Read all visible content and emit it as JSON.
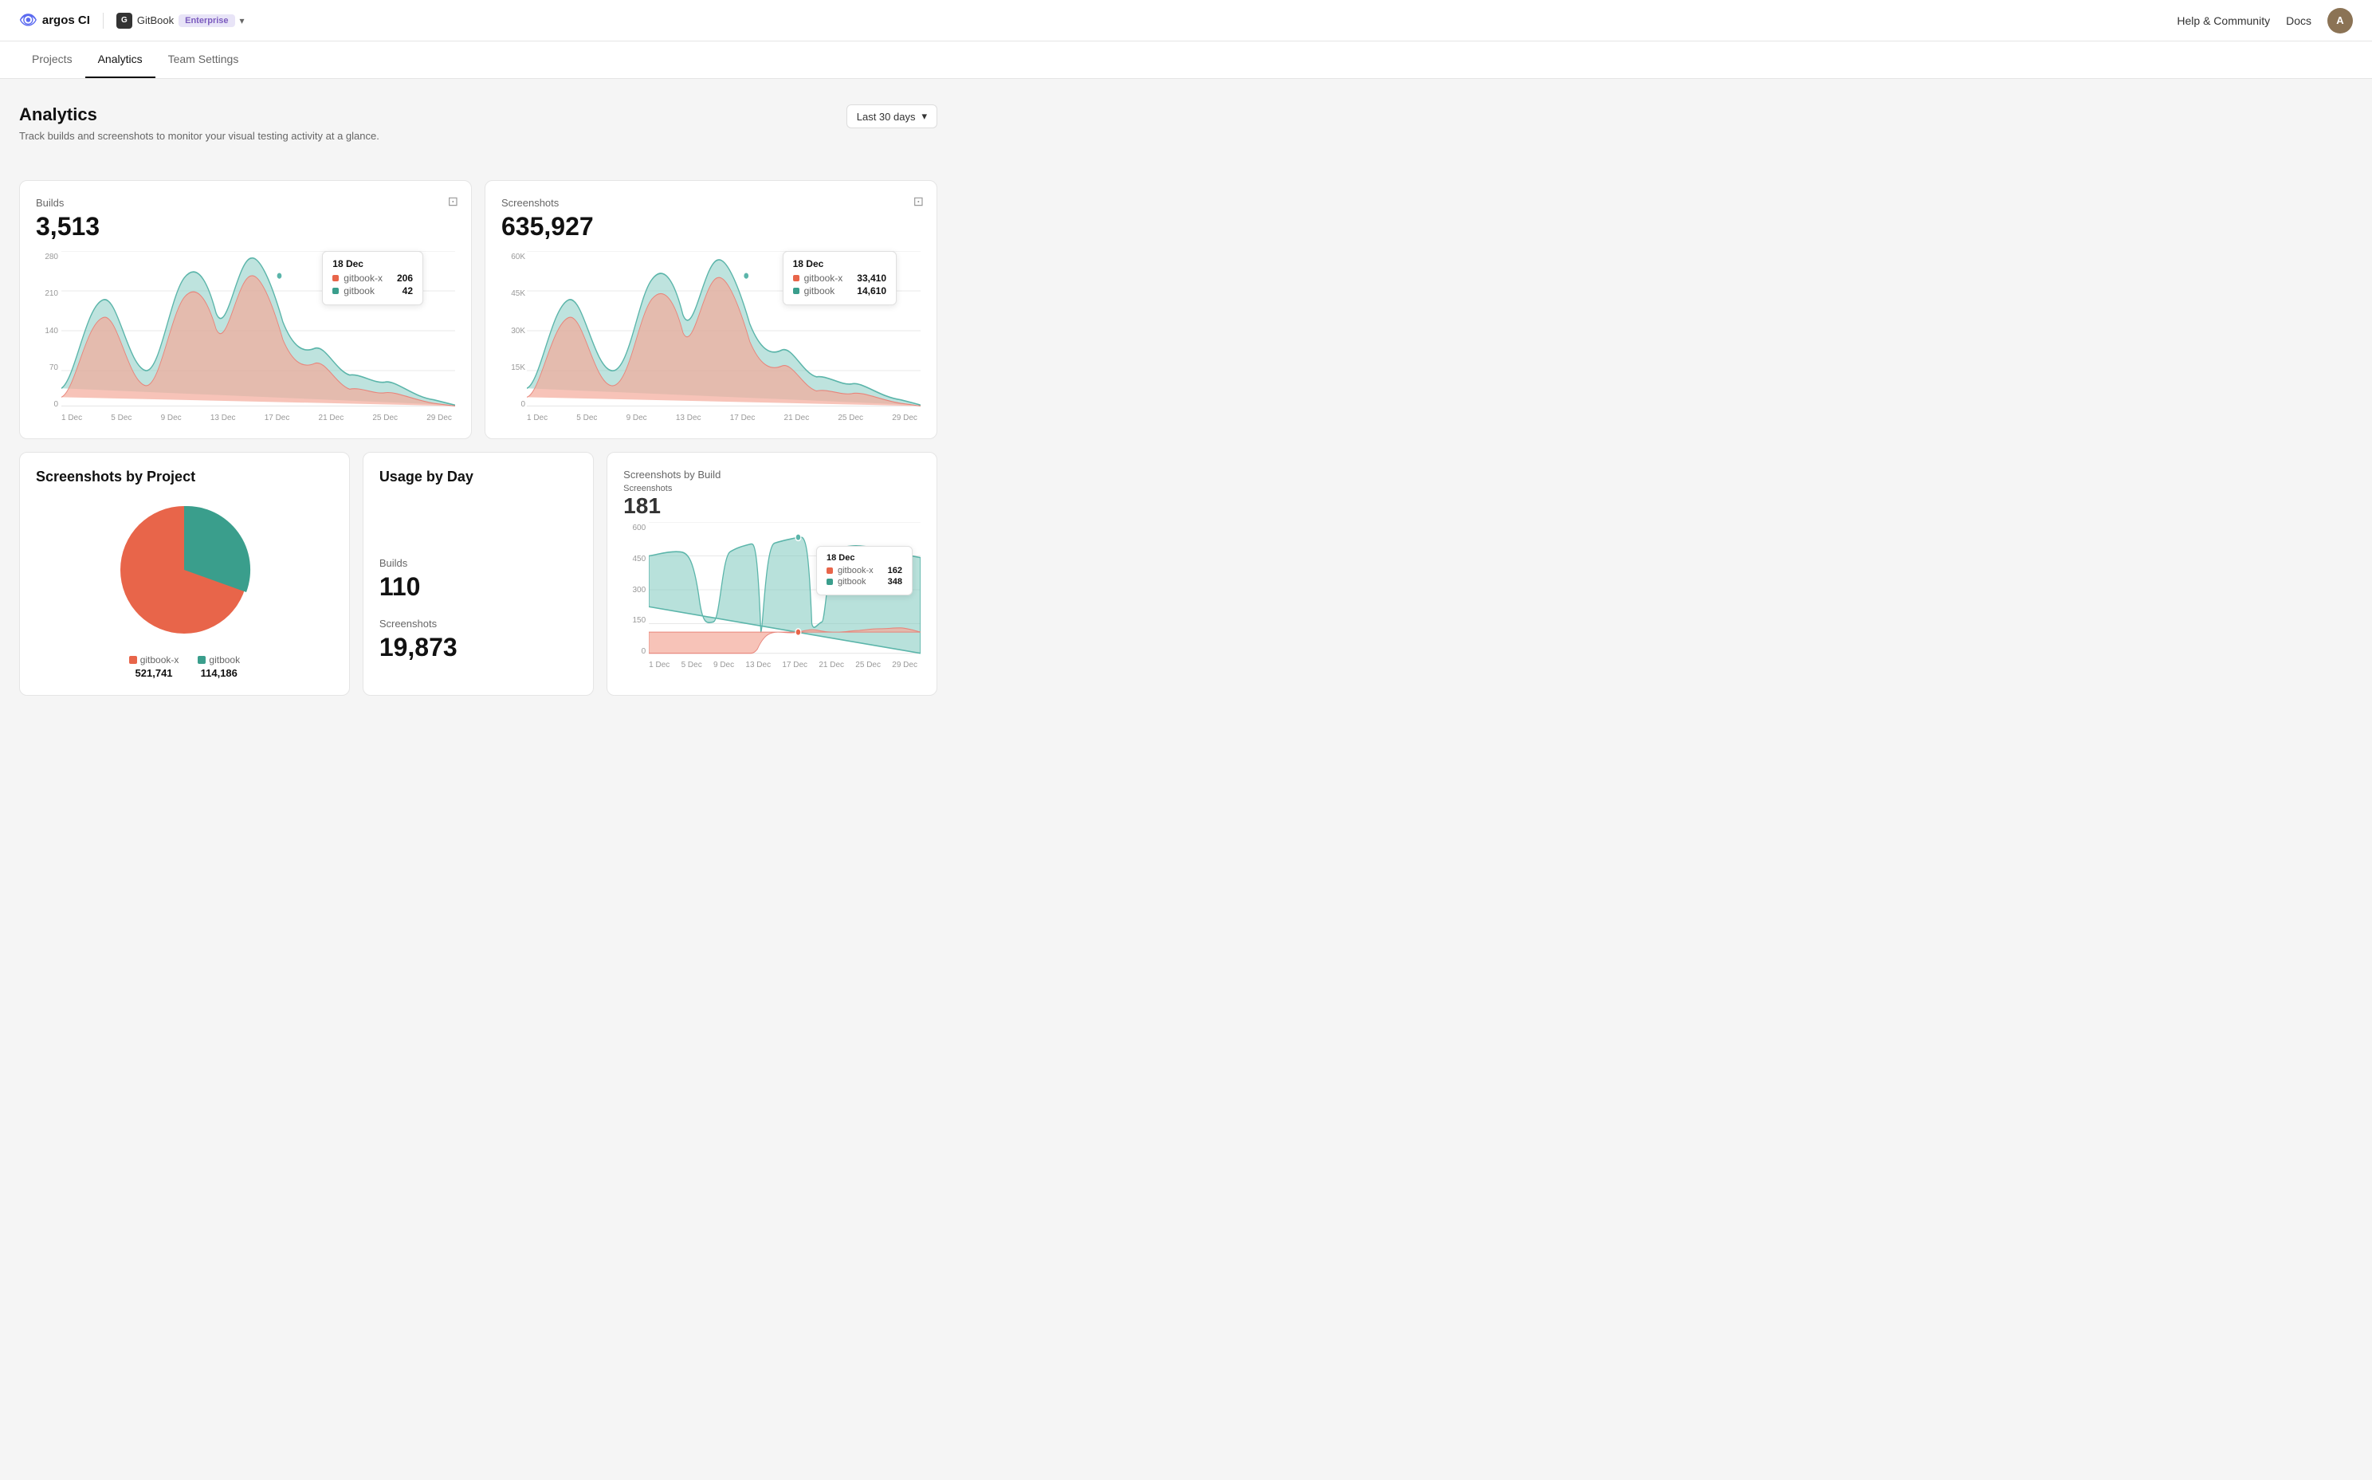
{
  "header": {
    "logo_text": "argos CI",
    "gitbook_label": "GitBook",
    "enterprise_label": "Enterprise",
    "help_link": "Help & Community",
    "docs_link": "Docs",
    "avatar_initials": "A"
  },
  "nav": {
    "items": [
      {
        "label": "Projects",
        "active": false
      },
      {
        "label": "Analytics",
        "active": true
      },
      {
        "label": "Team Settings",
        "active": false
      }
    ]
  },
  "page": {
    "title": "Analytics",
    "subtitle": "Track builds and screenshots to monitor your visual testing activity at a glance.",
    "period": "Last 30 days"
  },
  "builds_card": {
    "title": "Builds",
    "value": "3,513",
    "tooltip": {
      "date": "18 Dec",
      "row1_label": "gitbook-x",
      "row1_value": "206",
      "row2_label": "gitbook",
      "row2_value": "42"
    },
    "y_labels": [
      "280",
      "210",
      "140",
      "70",
      "0"
    ],
    "x_labels": [
      "1 Dec",
      "5 Dec",
      "9 Dec",
      "13 Dec",
      "17 Dec",
      "21 Dec",
      "25 Dec",
      "29 Dec"
    ]
  },
  "screenshots_card": {
    "title": "Screenshots",
    "value": "635,927",
    "tooltip": {
      "date": "18 Dec",
      "row1_label": "gitbook-x",
      "row1_value": "33,410",
      "row2_label": "gitbook",
      "row2_value": "14,610"
    },
    "y_labels": [
      "60K",
      "45K",
      "30K",
      "15K",
      "0"
    ],
    "x_labels": [
      "1 Dec",
      "5 Dec",
      "9 Dec",
      "13 Dec",
      "17 Dec",
      "21 Dec",
      "25 Dec",
      "29 Dec"
    ]
  },
  "screenshots_by_project": {
    "title": "Screenshots by Project",
    "legend": [
      {
        "label": "gitbook-x",
        "value": "521,741",
        "color": "#e8654a"
      },
      {
        "label": "gitbook",
        "value": "114,186",
        "color": "#3a9e8c"
      }
    ]
  },
  "usage_by_day": {
    "title": "Usage by Day",
    "builds_label": "Builds",
    "builds_value": "110",
    "screenshots_label": "Screenshots",
    "screenshots_value": "19,873"
  },
  "screenshots_by_build": {
    "title": "Screenshots by Build",
    "screenshots_label": "Screenshots",
    "screenshots_value": "181",
    "tooltip": {
      "date": "18 Dec",
      "row1_label": "gitbook-x",
      "row1_value": "162",
      "row2_label": "gitbook",
      "row2_value": "348"
    },
    "y_labels": [
      "600",
      "450",
      "300",
      "150",
      "0"
    ],
    "x_labels": [
      "1 Dec",
      "5 Dec",
      "9 Dec",
      "13 Dec",
      "17 Dec",
      "21 Dec",
      "25 Dec",
      "29 Dec"
    ]
  },
  "colors": {
    "salmon": "#f4a99a",
    "teal": "#7ec8be",
    "orange": "#e8654a",
    "green": "#3a9e8c"
  }
}
